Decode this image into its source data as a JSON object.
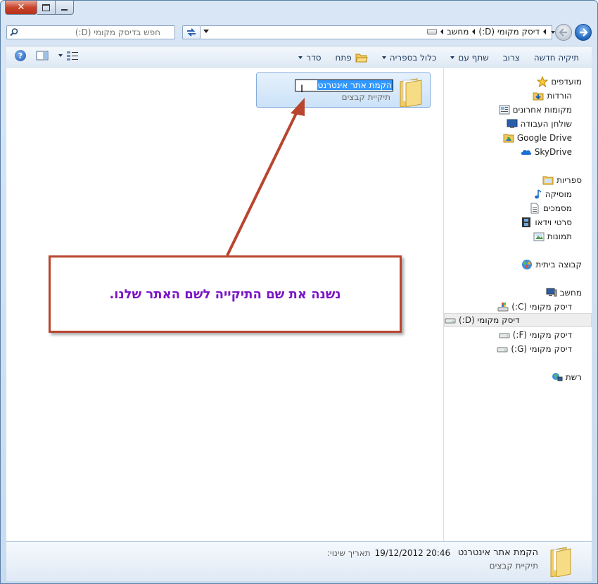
{
  "titlebar": {
    "close_label": "✕"
  },
  "address": {
    "breadcrumbs": [
      "מחשב",
      "דיסק מקומי (D:)"
    ],
    "search_placeholder": "חפש בדיסק מקומי (D:)"
  },
  "toolbar": {
    "items": [
      {
        "label": "סדר",
        "dropdown": true
      },
      {
        "label": "פתח",
        "dropdown": false
      },
      {
        "label": "כלול בספריה",
        "dropdown": true
      },
      {
        "label": "שתף עם",
        "dropdown": true
      },
      {
        "label": "צרוב",
        "dropdown": false
      },
      {
        "label": "תיקיה חדשה",
        "dropdown": false
      }
    ],
    "help_label": "?"
  },
  "sidebar": {
    "favorites": {
      "header": "מועדפים",
      "items": [
        "הורדות",
        "מקומות אחרונים",
        "שולחן העבודה",
        "Google Drive",
        "SkyDrive"
      ]
    },
    "libraries": {
      "header": "ספריות",
      "items": [
        "מוסיקה",
        "מסמכים",
        "סרטי וידאו",
        "תמונות"
      ]
    },
    "homegroup": {
      "header": "קבוצה ביתית"
    },
    "computer": {
      "header": "מחשב",
      "items": [
        "דיסק מקומי (C:)",
        "דיסק מקומי (D:)",
        "דיסק מקומי (F:)",
        "דיסק מקומי (G:)"
      ],
      "selected_index": 1
    },
    "network": {
      "header": "רשת"
    }
  },
  "main": {
    "folder": {
      "name": "הקמת אתר אינטרנט",
      "type": "תיקיית קבצים"
    },
    "annotation": "נשנה את שם התיקייה לשם האתר שלנו."
  },
  "details": {
    "name": "הקמת אתר אינטרנט",
    "type": "תיקיית קבצים",
    "date_label": "תאריך שינוי:",
    "date_value": "19/12/2012 20:46"
  },
  "colors": {
    "accent": "#3399ff",
    "annotation_border": "#b9452f",
    "annotation_text": "#7b16c4"
  }
}
